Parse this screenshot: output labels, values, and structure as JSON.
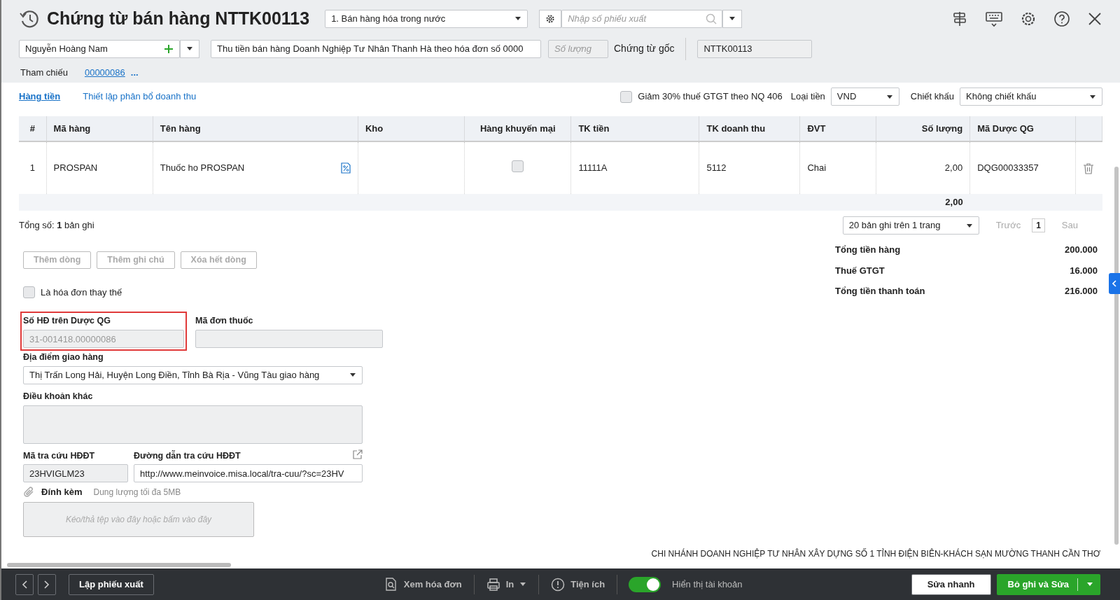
{
  "header": {
    "title": "Chứng từ bán hàng NTTK00113",
    "voucher_type": "1. Bán hàng hóa trong nước",
    "search": {
      "placeholder": "Nhập số phiếu xuất"
    }
  },
  "customer": {
    "value": "Nguyễn Hoàng Nam"
  },
  "description": {
    "value": "Thu tiền bán hàng Doanh Nghiệp Tư Nhân Thanh Hà theo hóa đơn số 0000"
  },
  "quantity": {
    "placeholder": "Số lượng"
  },
  "original_doc_label": "Chứng từ gốc",
  "voucher_no": {
    "value": "NTTK00113"
  },
  "reference": {
    "label": "Tham chiếu",
    "link": "00000086",
    "more": "..."
  },
  "tabs": [
    {
      "label": "Hàng tiền",
      "selected": true
    },
    {
      "label": "Thiết lập phân bổ doanh thu",
      "selected": false
    }
  ],
  "vat_reduction": {
    "label": "Giảm 30% thuế GTGT theo NQ 406",
    "checked": false
  },
  "currency": {
    "label": "Loại tiền",
    "value": "VND"
  },
  "discount": {
    "label": "Chiết khấu",
    "value": "Không chiết khấu"
  },
  "table": {
    "columns": [
      "#",
      "Mã hàng",
      "Tên hàng",
      "Kho",
      "Hàng khuyến mại",
      "TK tiền",
      "TK doanh thu",
      "ĐVT",
      "Số lượng",
      "Mã Dược QG"
    ],
    "rows": [
      {
        "cells": [
          "1",
          "PROSPAN",
          "Thuốc ho PROSPAN",
          "",
          "",
          "11111A",
          "5112",
          "Chai",
          "2,00",
          "DQG00033357"
        ],
        "promotion": false
      }
    ],
    "footer_quantity": "2,00"
  },
  "record_count": "Tổng số: **1** bản ghi",
  "pagination": {
    "page_size": "20 bản ghi trên 1 trang",
    "prev": "Trước",
    "page": "1",
    "next": "Sau"
  },
  "row_buttons": [
    "Thêm dòng",
    "Thêm ghi chú",
    "Xóa hết dòng"
  ],
  "replacement_invoice": {
    "label": "Là hóa đơn thay thế",
    "checked": false
  },
  "drug_invoice": {
    "label": "Số HĐ trên Dược QG",
    "value": "31-001418.00000086",
    "disabled": true,
    "highlighted": true
  },
  "prescription": {
    "label": "Mã đơn thuốc"
  },
  "delivery": {
    "label": "Địa điểm giao hàng",
    "value": "Thị Trấn Long Hải, Huyện Long Điền, Tỉnh Bà Rịa - Vũng Tàu giao hàng"
  },
  "other_terms": {
    "label": "Điều khoản khác"
  },
  "lookup_code": {
    "label": "Mã tra cứu HĐĐT",
    "value": "23HVIGLM23"
  },
  "lookup_link": {
    "label": "Đường dẫn tra cứu HĐĐT",
    "value": "http://www.meinvoice.misa.local/tra-cuu/?sc=23HV"
  },
  "attachment": {
    "label": "Đính kèm",
    "hint": "Dung lượng tối đa 5MB",
    "dropzone": "Kéo/thả tệp vào đây hoặc bấm vào đây"
  },
  "totals": [
    {
      "label": "Tổng tiền hàng",
      "value": "200.000"
    },
    {
      "label": "Thuế GTGT",
      "value": "16.000"
    },
    {
      "label": "Tổng tiền thanh toán",
      "value": "216.000"
    }
  ],
  "company_name": "CHI NHÁNH DOANH NGHIỆP TƯ NHÂN XÂY DỰNG SỐ 1 TỈNH ĐIỆN BIÊN-KHÁCH SẠN MƯỜNG THANH CẦN THƠ",
  "bottom_bar": {
    "create_button": "Lập phiếu xuất",
    "view_invoice": "Xem hóa đơn",
    "print": "In",
    "utilities": "Tiện ích",
    "show_accounts": {
      "label": "Hiển thị tài khoản",
      "on": true
    },
    "quick_edit": "Sửa nhanh",
    "save": "Bỏ ghi và Sửa"
  }
}
